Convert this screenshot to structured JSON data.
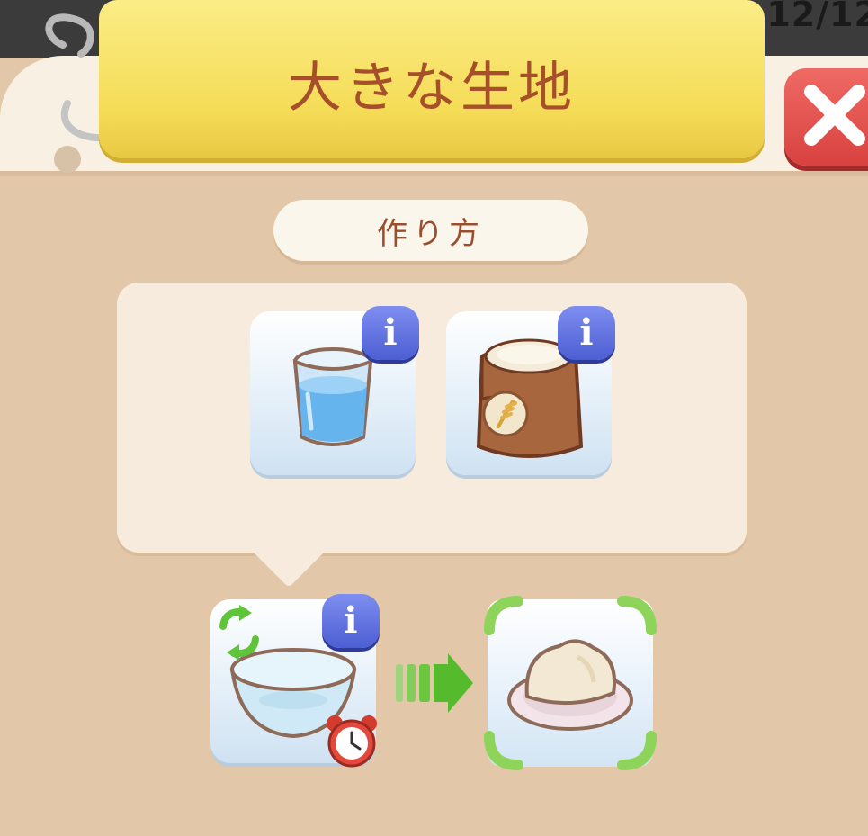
{
  "hud": {
    "counter": "12/12"
  },
  "dialog": {
    "title": "大きな生地",
    "section_label": "作り方"
  },
  "info_label": "i",
  "ingredients": [
    {
      "icon": "water-glass-icon"
    },
    {
      "icon": "flour-sack-icon"
    }
  ],
  "recipe": {
    "tool_icon": "mixing-bowl-icon",
    "timer_icon": "alarm-clock-icon",
    "cycle_icon": "refresh-arrows-icon",
    "result_icon": "dough-on-plate-icon"
  },
  "colors": {
    "banner": "#f5dc57",
    "title_text": "#a64f2a",
    "close_button": "#d8423f",
    "info_badge": "#4c5ed3",
    "panel": "#e2c7a9",
    "result_corner": "#8fd45a"
  }
}
